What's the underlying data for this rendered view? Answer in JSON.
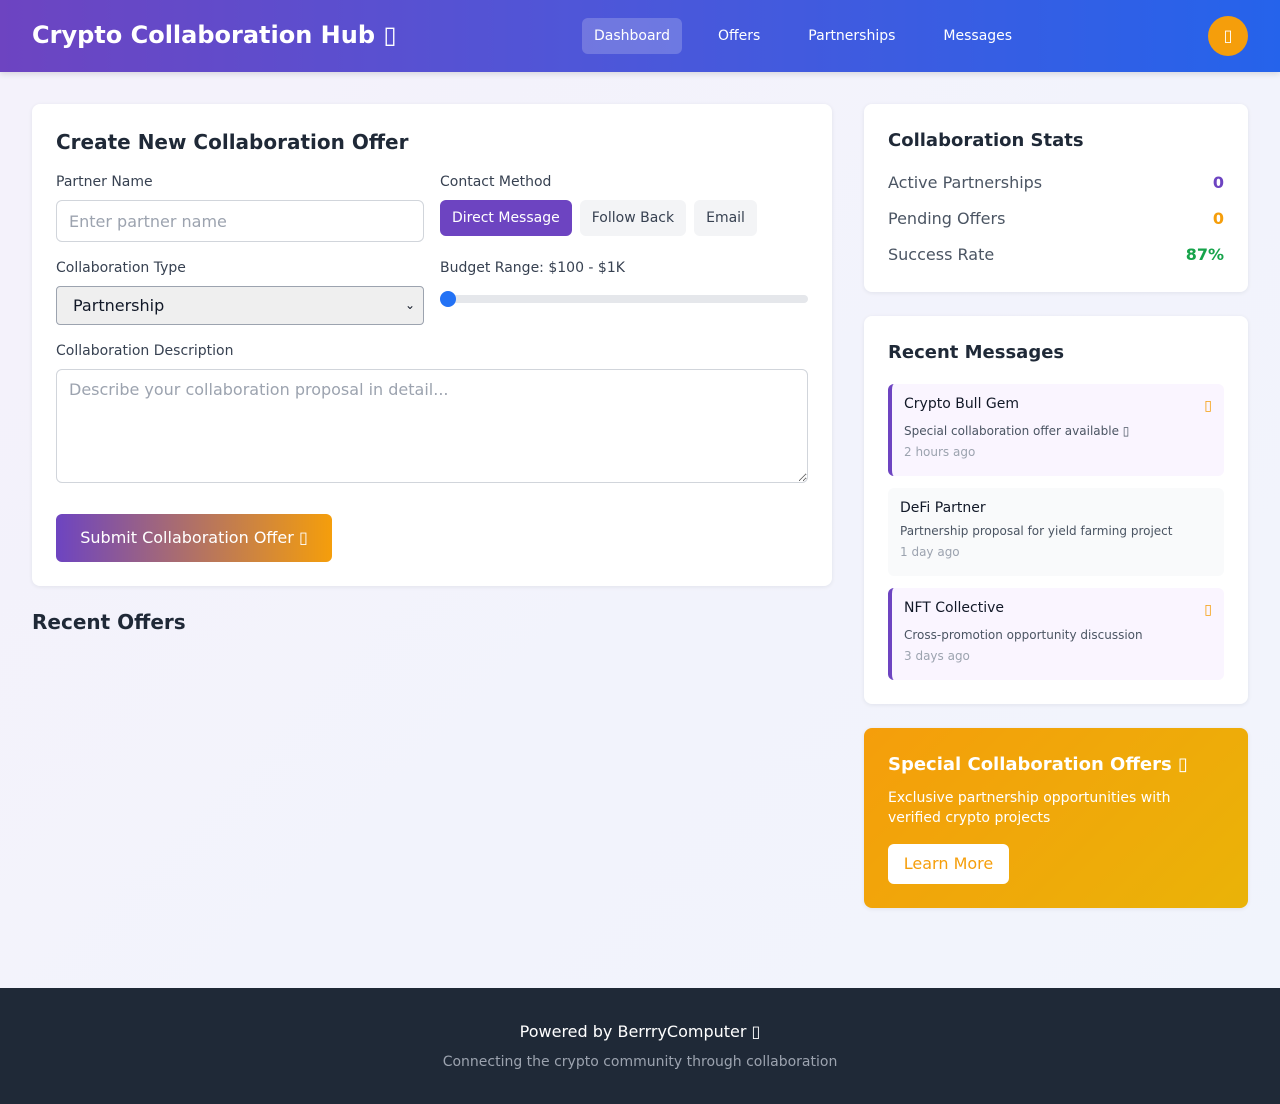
{
  "header": {
    "brand": "Crypto Collaboration Hub ▯",
    "nav": [
      "Dashboard",
      "Offers",
      "Partnerships",
      "Messages"
    ],
    "active_nav": "Dashboard",
    "user_icon": "▯"
  },
  "offer_form": {
    "title": "Create New Collaboration Offer",
    "partner_label": "Partner Name",
    "partner_placeholder": "Enter partner name",
    "partner_value": "",
    "contact_label": "Contact Method",
    "contact_options": [
      "Direct Message",
      "Follow Back",
      "Email"
    ],
    "contact_selected": "Direct Message",
    "type_label": "Collaboration Type",
    "type_selected": "Partnership",
    "budget_label": "Budget Range: $100 - $1K",
    "budget_slider_fraction": 0,
    "description_label": "Collaboration Description",
    "description_placeholder": "Describe your collaboration proposal in detail...",
    "submit_label": "Submit Collaboration Offer ▯"
  },
  "recent_offers": {
    "title": "Recent Offers"
  },
  "stats": {
    "title": "Collaboration Stats",
    "items": [
      {
        "label": "Active Partnerships",
        "value": "0",
        "color": "#6d44c1"
      },
      {
        "label": "Pending Offers",
        "value": "0",
        "color": "#f59e0b"
      },
      {
        "label": "Success Rate",
        "value": "87%",
        "color": "#16a34a"
      }
    ]
  },
  "messages": {
    "title": "Recent Messages",
    "items": [
      {
        "sender": "Crypto Bull Gem",
        "preview": "Special collaboration offer available ▯",
        "time": "2 hours ago",
        "unread": true,
        "flag": "▯"
      },
      {
        "sender": "DeFi Partner",
        "preview": "Partnership proposal for yield farming project",
        "time": "1 day ago",
        "unread": false
      },
      {
        "sender": "NFT Collective",
        "preview": "Cross-promotion opportunity discussion",
        "time": "3 days ago",
        "unread": true,
        "flag": "▯"
      }
    ]
  },
  "promo": {
    "title": "Special Collaboration Offers ▯",
    "text": "Exclusive partnership opportunities with verified crypto projects",
    "button": "Learn More"
  },
  "footer": {
    "main": "Powered by BerrryComputer ▯",
    "sub": "Connecting the crypto community through collaboration"
  },
  "colors": {
    "primary": "#6d44c1",
    "accent": "#f59e0b",
    "success": "#16a34a",
    "header_gradient_end": "#2563eb",
    "footer_bg": "#1f2937"
  }
}
